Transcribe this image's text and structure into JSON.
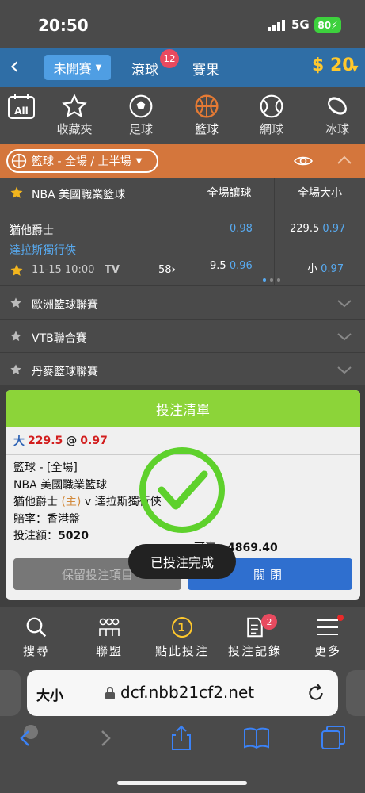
{
  "status": {
    "time": "20:50",
    "network": "5G",
    "battery": "80"
  },
  "topnav": {
    "back_icon": "chevron-left-icon",
    "mode": "未開賽",
    "live": "滾球",
    "live_count": "12",
    "results": "賽果",
    "balance": "$ 20"
  },
  "sports": [
    {
      "icon": "calendar-all-icon",
      "label": "All",
      "text": ""
    },
    {
      "icon": "star-icon",
      "label": "",
      "text": "收藏夾"
    },
    {
      "icon": "soccer-ball-icon",
      "label": "",
      "text": "足球"
    },
    {
      "icon": "basketball-icon",
      "label": "",
      "text": "籃球"
    },
    {
      "icon": "tennis-ball-icon",
      "label": "",
      "text": "網球"
    },
    {
      "icon": "hockey-puck-icon",
      "label": "",
      "text": "冰球"
    }
  ],
  "filter": {
    "label": "籃球 - 全場 / 上半場"
  },
  "league": {
    "name": "NBA 美國職業籃球",
    "col1": "全場讓球",
    "col2": "全場大小"
  },
  "match": {
    "home": "猶他爵士",
    "away": "達拉斯獨行俠",
    "datetime": "11-15 10:00",
    "tv": "TV",
    "more": "58",
    "hdp_home_price": "0.98",
    "hdp_away_line": "9.5",
    "hdp_away_price": "0.96",
    "ou_over_line": "229.5",
    "ou_over_price": "0.97",
    "ou_under_line": "小",
    "ou_under_price": "0.97"
  },
  "other_leagues": [
    "歐洲籃球聯賽",
    "VTB聯合賽",
    "丹麥籃球聯賽"
  ],
  "betslip": {
    "title": "投注清單",
    "selection": "大",
    "line": "229.5",
    "at": "@",
    "price": "0.97",
    "sport": "籃球 - [全場]",
    "league": "NBA 美國職業籃球",
    "home": "猶他爵士",
    "home_tag": "(主)",
    "vs": "v",
    "away": "達拉斯獨行俠",
    "odds_label": "賠率：香港盤",
    "stake_label": "投注額：",
    "stake": "5020",
    "towin_label": "可贏：",
    "towin": "4869.40",
    "keep": "保留投注項目",
    "close": "關閉"
  },
  "toast": "已投注完成",
  "tabbar": [
    {
      "icon": "search-icon",
      "label": "搜尋"
    },
    {
      "icon": "people-icon",
      "label": "聯盟"
    },
    {
      "icon": "coin-icon",
      "label": "點此投注",
      "value": "1"
    },
    {
      "icon": "receipt-icon",
      "label": "投注記錄",
      "badge": "2"
    },
    {
      "icon": "menu-icon",
      "label": "更多"
    }
  ],
  "browser": {
    "text_size": "大小",
    "url": "dcf.nbb21cf2.net"
  },
  "colors": {
    "accent_blue": "#2f6ea6",
    "orange": "#d4763c",
    "green": "#8cd439",
    "gold": "#ffc82c",
    "link_blue": "#58aaf0"
  }
}
